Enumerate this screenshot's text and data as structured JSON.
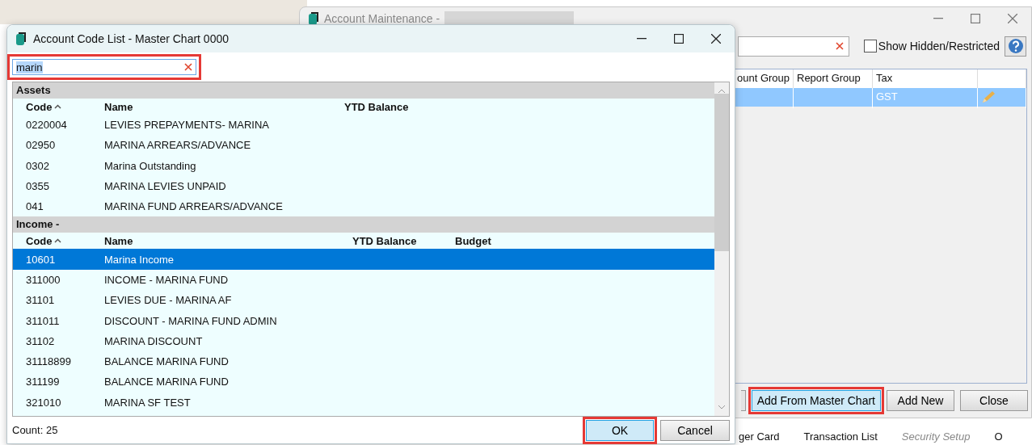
{
  "main_window": {
    "title": "Account Maintenance -",
    "show_hidden": {
      "label": "Show Hidden/Restricted",
      "checked": false
    },
    "columns": [
      "ount Group",
      "Report Group",
      "Tax"
    ],
    "rows": [
      {
        "tax": "GST",
        "selected": true
      }
    ],
    "buttons": [
      {
        "label": "Add From Master Chart",
        "highlighted": true
      },
      {
        "label": "Add New",
        "highlighted": false
      },
      {
        "label": "Close",
        "highlighted": false
      }
    ]
  },
  "toolbar": [
    {
      "label": "ger Card",
      "disabled": false
    },
    {
      "label": "Transaction List",
      "disabled": false
    },
    {
      "label": "Security Setup",
      "disabled": true
    },
    {
      "label": "O",
      "disabled": false
    }
  ],
  "dialog": {
    "title": "Account Code List - Master Chart 0000",
    "search": {
      "value": "marin",
      "highlighted": true
    },
    "sections": [
      {
        "title": "Assets",
        "columns": [
          "Code",
          "Name",
          "YTD Balance"
        ],
        "rows": [
          {
            "code": "0220004",
            "name": "LEVIES PREPAYMENTS- MARINA",
            "selected": false
          },
          {
            "code": "02950",
            "name": "MARINA ARREARS/ADVANCE",
            "selected": false
          },
          {
            "code": "0302",
            "name": "Marina Outstanding",
            "selected": false
          },
          {
            "code": "0355",
            "name": "MARINA LEVIES UNPAID",
            "selected": false
          },
          {
            "code": "041",
            "name": "MARINA FUND ARREARS/ADVANCE",
            "selected": false
          }
        ]
      },
      {
        "title": "Income -",
        "columns": [
          "Code",
          "Name",
          "YTD Balance",
          "Budget"
        ],
        "rows": [
          {
            "code": "10601",
            "name": "Marina Income",
            "selected": true
          },
          {
            "code": "311000",
            "name": "INCOME - MARINA FUND",
            "selected": false
          },
          {
            "code": "31101",
            "name": "LEVIES DUE - MARINA AF",
            "selected": false
          },
          {
            "code": "311011",
            "name": "DISCOUNT - MARINA FUND ADMIN",
            "selected": false
          },
          {
            "code": "31102",
            "name": "MARINA DISCOUNT",
            "selected": false
          },
          {
            "code": "31118899",
            "name": "BALANCE MARINA FUND",
            "selected": false
          },
          {
            "code": "311199",
            "name": "BALANCE MARINA FUND",
            "selected": false
          },
          {
            "code": "321010",
            "name": "MARINA SF TEST",
            "selected": false
          }
        ]
      }
    ],
    "count": "Count: 25",
    "buttons": [
      {
        "label": "OK",
        "highlighted": true
      },
      {
        "label": "Cancel",
        "highlighted": false
      }
    ]
  }
}
